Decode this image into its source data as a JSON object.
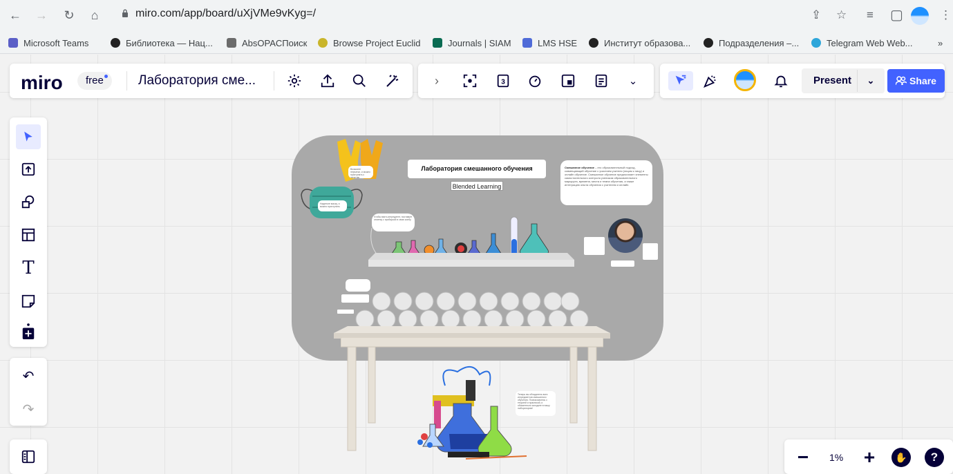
{
  "browser": {
    "url": "miro.com/app/board/uXjVMe9vKyg=/",
    "bookmarks": [
      {
        "label": "Microsoft Teams",
        "color": "#5b5fc7"
      },
      {
        "label": "Библиотека — Нац...",
        "color": "#222"
      },
      {
        "label": "AbsOPACПоиск",
        "color": "#6b6b6b"
      },
      {
        "label": "Browse Project Euclid",
        "color": "#c9b52b"
      },
      {
        "label": "Journals | SIAM",
        "color": "#0a6b52"
      },
      {
        "label": "LMS HSE",
        "color": "#4f6bd8"
      },
      {
        "label": "Институт образова...",
        "color": "#222"
      },
      {
        "label": "Подразделения –...",
        "color": "#222"
      },
      {
        "label": "Telegram Web Web...",
        "color": "#2ea6da"
      }
    ],
    "more_label": "»"
  },
  "miro": {
    "logo": "miro",
    "plan": "free",
    "board_title": "Лаборатория сме...",
    "present_label": "Present",
    "share_label": "Share",
    "zoom": "1%",
    "accent": "#4262ff"
  },
  "board": {
    "title": "Лаборатория смешанного обучения",
    "subtitle": "Blended Learning",
    "description_bold": "Смешанное обучение",
    "description": " – это образовательный подход, совмещающий обучение с участием учителя (лицом к лицу) и онлайн обучение. Смешанное обучение предполагает элементы самостоятельного контроля учеником образовательного маршрута, времени, места и темпа обучения, а также интеграцию опыта обучения с учителем и онлайн.",
    "note_gloves": "Возьмите перчатки, и можно приступать к занятию",
    "note_mask": "Наденьте маску, и можно приступать",
    "note_prompt": "Чтобы взять ингредиент, поставьте отметку с пробиркой в свою колбу",
    "note_bottom": "Теперь вы обладатель всех ингредиентов смешанного обучения. Познакомьтесь с теорией и практикой, и обязательно заходите в нашу лабораторию!"
  }
}
